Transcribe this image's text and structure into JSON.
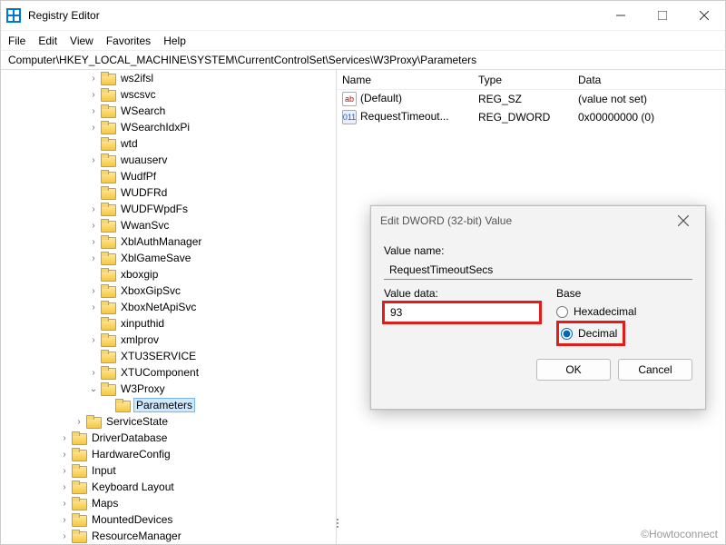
{
  "window": {
    "title": "Registry Editor"
  },
  "menu": [
    "File",
    "Edit",
    "View",
    "Favorites",
    "Help"
  ],
  "address": "Computer\\HKEY_LOCAL_MACHINE\\SYSTEM\\CurrentControlSet\\Services\\W3Proxy\\Parameters",
  "tree": [
    {
      "indent": 6,
      "chev": "closed",
      "label": "ws2ifsl"
    },
    {
      "indent": 6,
      "chev": "closed",
      "label": "wscsvc"
    },
    {
      "indent": 6,
      "chev": "closed",
      "label": "WSearch"
    },
    {
      "indent": 6,
      "chev": "closed",
      "label": "WSearchIdxPi"
    },
    {
      "indent": 6,
      "chev": "none",
      "label": "wtd"
    },
    {
      "indent": 6,
      "chev": "closed",
      "label": "wuauserv"
    },
    {
      "indent": 6,
      "chev": "none",
      "label": "WudfPf"
    },
    {
      "indent": 6,
      "chev": "none",
      "label": "WUDFRd"
    },
    {
      "indent": 6,
      "chev": "closed",
      "label": "WUDFWpdFs"
    },
    {
      "indent": 6,
      "chev": "closed",
      "label": "WwanSvc"
    },
    {
      "indent": 6,
      "chev": "closed",
      "label": "XblAuthManager"
    },
    {
      "indent": 6,
      "chev": "closed",
      "label": "XblGameSave"
    },
    {
      "indent": 6,
      "chev": "none",
      "label": "xboxgip"
    },
    {
      "indent": 6,
      "chev": "closed",
      "label": "XboxGipSvc"
    },
    {
      "indent": 6,
      "chev": "closed",
      "label": "XboxNetApiSvc"
    },
    {
      "indent": 6,
      "chev": "none",
      "label": "xinputhid"
    },
    {
      "indent": 6,
      "chev": "closed",
      "label": "xmlprov"
    },
    {
      "indent": 6,
      "chev": "none",
      "label": "XTU3SERVICE"
    },
    {
      "indent": 6,
      "chev": "closed",
      "label": "XTUComponent"
    },
    {
      "indent": 6,
      "chev": "open",
      "label": "W3Proxy"
    },
    {
      "indent": 7,
      "chev": "none",
      "label": "Parameters",
      "selected": true
    },
    {
      "indent": 5,
      "chev": "closed",
      "label": "ServiceState"
    },
    {
      "indent": 4,
      "chev": "closed",
      "label": "DriverDatabase"
    },
    {
      "indent": 4,
      "chev": "closed",
      "label": "HardwareConfig"
    },
    {
      "indent": 4,
      "chev": "closed",
      "label": "Input"
    },
    {
      "indent": 4,
      "chev": "closed",
      "label": "Keyboard Layout"
    },
    {
      "indent": 4,
      "chev": "closed",
      "label": "Maps"
    },
    {
      "indent": 4,
      "chev": "closed",
      "label": "MountedDevices"
    },
    {
      "indent": 4,
      "chev": "closed",
      "label": "ResourceManager"
    }
  ],
  "cols": {
    "name": "Name",
    "type": "Type",
    "data": "Data"
  },
  "values": [
    {
      "ic": "sz",
      "icGlyph": "ab",
      "name": "(Default)",
      "type": "REG_SZ",
      "data": "(value not set)"
    },
    {
      "ic": "dw",
      "icGlyph": "011",
      "name": "RequestTimeout...",
      "type": "REG_DWORD",
      "data": "0x00000000 (0)"
    }
  ],
  "dlg": {
    "title": "Edit DWORD (32-bit) Value",
    "value_name_lbl": "Value name:",
    "value_name": "RequestTimeoutSecs",
    "value_data_lbl": "Value data:",
    "value_data": "93",
    "base_lbl": "Base",
    "hex": "Hexadecimal",
    "dec": "Decimal",
    "ok": "OK",
    "cancel": "Cancel"
  },
  "watermark": "©Howtoconnect"
}
